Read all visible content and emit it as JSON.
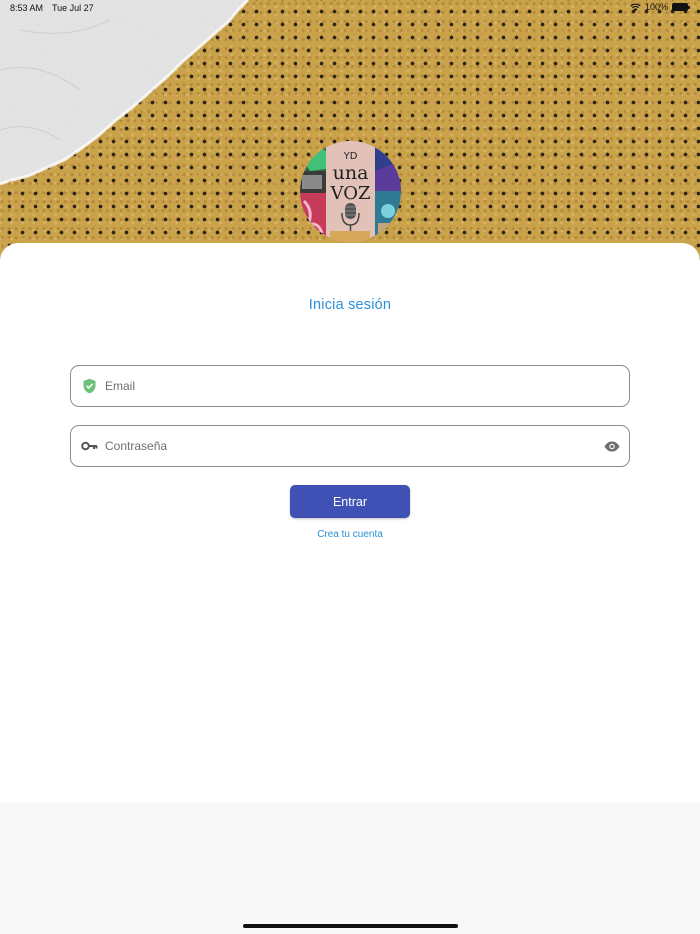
{
  "status_bar": {
    "time": "8:53 AM",
    "date": "Tue Jul 27",
    "battery": "100%"
  },
  "logo": {
    "name": "YD una voz logo"
  },
  "login": {
    "title": "Inicia sesión",
    "email_placeholder": "Email",
    "email_value": "",
    "password_placeholder": "Contraseña",
    "password_value": "",
    "submit_label": "Entrar",
    "create_account_label": "Crea tu cuenta"
  },
  "icons": {
    "email": "verified-shield-icon",
    "password": "key-icon",
    "toggle": "eye-icon",
    "wifi": "wifi-icon",
    "battery": "battery-icon"
  },
  "colors": {
    "accent": "#2a8fd9",
    "button": "#3f51b5",
    "shield": "#6cc17a",
    "field_border": "#8d8d8d"
  }
}
